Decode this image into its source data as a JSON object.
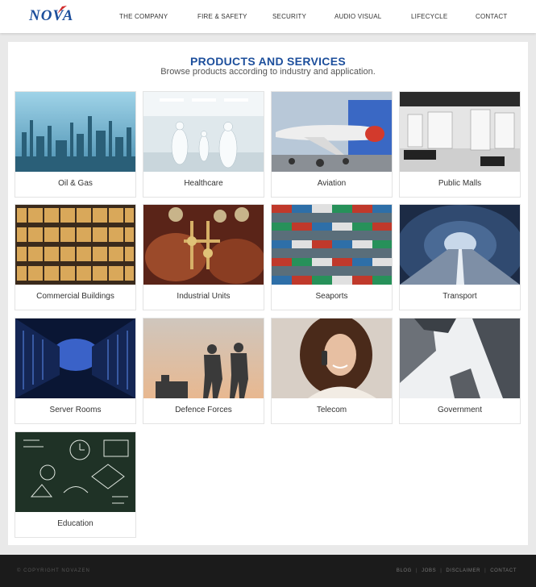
{
  "header": {
    "logo": "NOVA",
    "nav": [
      "THE COMPANY",
      "FIRE & SAFETY",
      "SECURITY",
      "AUDIO VISUAL",
      "LIFECYCLE",
      "CONTACT"
    ]
  },
  "main": {
    "title": "PRODUCTS AND SERVICES",
    "subtitle": "Browse products according to industry and application.",
    "categories": [
      {
        "label": "Oil & Gas",
        "image_icon": "refinery-photo"
      },
      {
        "label": "Healthcare",
        "image_icon": "cleanroom-photo"
      },
      {
        "label": "Aviation",
        "image_icon": "jet-photo"
      },
      {
        "label": "Public Malls",
        "image_icon": "store-photo"
      },
      {
        "label": "Commercial Buildings",
        "image_icon": "office-building-photo"
      },
      {
        "label": "Industrial Units",
        "image_icon": "valves-photo"
      },
      {
        "label": "Seaports",
        "image_icon": "containers-photo"
      },
      {
        "label": "Transport",
        "image_icon": "tunnel-photo"
      },
      {
        "label": "Server Rooms",
        "image_icon": "server-rack-photo"
      },
      {
        "label": "Defence Forces",
        "image_icon": "soldiers-photo"
      },
      {
        "label": "Telecom",
        "image_icon": "phone-woman-photo"
      },
      {
        "label": "Government",
        "image_icon": "skyscrapers-photo"
      },
      {
        "label": "Education",
        "image_icon": "chalkboard-photo"
      }
    ]
  },
  "footer": {
    "copyright": "© COPYRIGHT NOVAZEN",
    "links": [
      "BLOG",
      "JOBS",
      "DISCLAIMER",
      "CONTACT"
    ]
  },
  "colors": {
    "brand": "#1d4f9c",
    "logo_accent": "#d22b2b",
    "footer_bg": "#1b1b1b",
    "page_bg": "#e9e9e9"
  }
}
